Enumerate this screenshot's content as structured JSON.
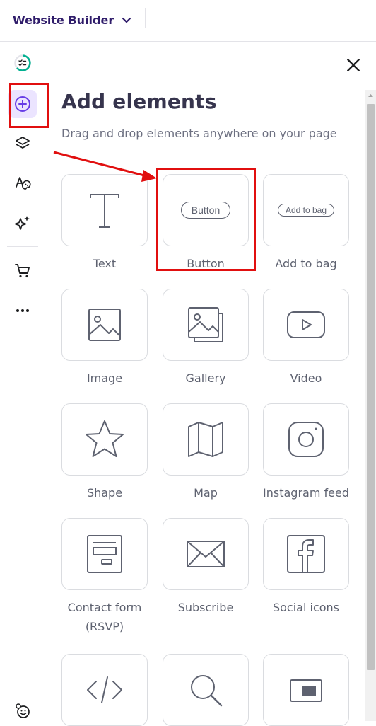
{
  "topbar": {
    "app_title": "Website Builder",
    "chevron_icon": "chevron-down-icon"
  },
  "sidebar": {
    "items": [
      {
        "name": "checklist-progress",
        "icon": "checklist-progress-icon",
        "active": false
      },
      {
        "name": "add-elements",
        "icon": "plus-circle-icon",
        "active": true
      },
      {
        "name": "layers",
        "icon": "layers-icon",
        "active": false
      },
      {
        "name": "styles",
        "icon": "text-palette-icon",
        "active": false
      },
      {
        "name": "ai-tools",
        "icon": "sparkles-icon",
        "active": false
      },
      {
        "name": "ecommerce",
        "icon": "cart-icon",
        "active": false
      },
      {
        "name": "more",
        "icon": "more-icon",
        "active": false
      },
      {
        "name": "accessibility",
        "icon": "face-icon",
        "active": false
      }
    ]
  },
  "panel": {
    "title": "Add elements",
    "subtitle": "Drag and drop elements anywhere on your page",
    "close_icon": "close-icon",
    "elements": [
      {
        "label": "Text",
        "icon": "text-icon"
      },
      {
        "label": "Button",
        "icon": "button-icon",
        "preview": "Button"
      },
      {
        "label": "Add to bag",
        "icon": "add-to-bag-icon",
        "preview": "Add to bag"
      },
      {
        "label": "Image",
        "icon": "image-icon"
      },
      {
        "label": "Gallery",
        "icon": "gallery-icon"
      },
      {
        "label": "Video",
        "icon": "video-icon"
      },
      {
        "label": "Shape",
        "icon": "star-icon"
      },
      {
        "label": "Map",
        "icon": "map-icon"
      },
      {
        "label": "Instagram feed",
        "icon": "instagram-icon"
      },
      {
        "label": "Contact form",
        "label_line2": "(RSVP)",
        "icon": "form-icon"
      },
      {
        "label": "Subscribe",
        "icon": "envelope-icon"
      },
      {
        "label": "Social icons",
        "icon": "facebook-icon"
      },
      {
        "label": "",
        "icon": "code-icon"
      },
      {
        "label": "",
        "icon": "search-icon"
      },
      {
        "label": "",
        "icon": "embed-icon"
      }
    ]
  },
  "annotation_color": "#e10f0f"
}
